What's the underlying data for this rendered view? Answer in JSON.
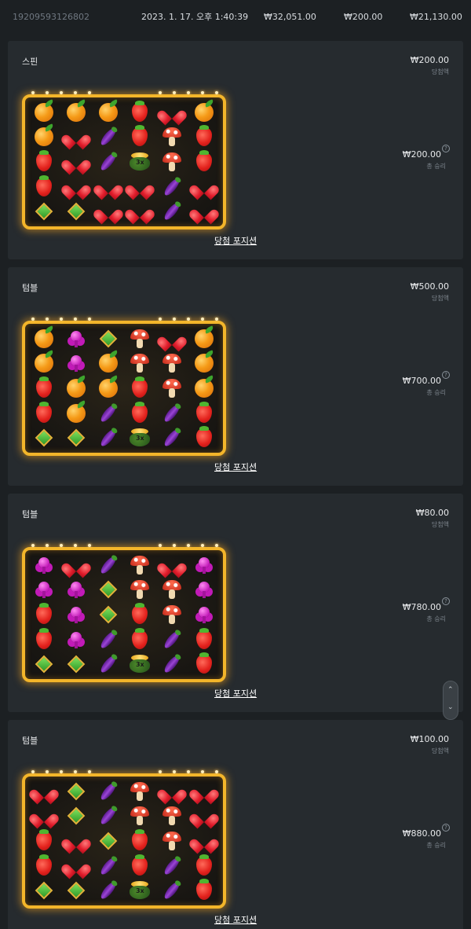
{
  "header": {
    "id": "19209593126802",
    "datetime": "2023. 1. 17. 오후 1:40:39",
    "amount1": "₩32,051.00",
    "amount2": "₩200.00",
    "amount3": "₩21,130.00"
  },
  "labels": {
    "win_amount_label": "당첨액",
    "total_win_label": "총 승리",
    "win_positions_link": "당첨 포지션",
    "help_icon": "?"
  },
  "rounds": [
    {
      "title": "스핀",
      "win_amount": "₩200.00",
      "total_win": "₩200.00",
      "grid": [
        [
          "orange",
          "orange",
          "orange",
          "strawberry",
          "heart",
          "orange"
        ],
        [
          "orange",
          "heart",
          "eggplant",
          "strawberry",
          "mushroom",
          "strawberry"
        ],
        [
          "strawberry",
          "heart",
          "eggplant",
          "pot",
          "mushroom",
          "strawberry"
        ],
        [
          "strawberry",
          "heart",
          "heart",
          "heart",
          "eggplant",
          "heart"
        ],
        [
          "diamond",
          "diamond",
          "heart",
          "heart",
          "eggplant",
          "heart"
        ]
      ]
    },
    {
      "title": "텀블",
      "win_amount": "₩500.00",
      "total_win": "₩700.00",
      "grid": [
        [
          "orange",
          "club",
          "diamond",
          "mushroom",
          "heart",
          "orange"
        ],
        [
          "orange",
          "club",
          "orange",
          "mushroom",
          "mushroom",
          "orange"
        ],
        [
          "strawberry",
          "orange",
          "orange",
          "strawberry",
          "mushroom",
          "orange"
        ],
        [
          "strawberry",
          "orange",
          "eggplant",
          "strawberry",
          "eggplant",
          "strawberry"
        ],
        [
          "diamond",
          "diamond",
          "eggplant",
          "pot",
          "eggplant",
          "strawberry"
        ]
      ]
    },
    {
      "title": "텀블",
      "win_amount": "₩80.00",
      "total_win": "₩780.00",
      "grid": [
        [
          "club",
          "heart",
          "eggplant",
          "mushroom",
          "heart",
          "club"
        ],
        [
          "club",
          "club",
          "diamond",
          "mushroom",
          "mushroom",
          "club"
        ],
        [
          "strawberry",
          "club",
          "diamond",
          "strawberry",
          "mushroom",
          "club"
        ],
        [
          "strawberry",
          "club",
          "eggplant",
          "strawberry",
          "eggplant",
          "strawberry"
        ],
        [
          "diamond",
          "diamond",
          "eggplant",
          "pot",
          "eggplant",
          "strawberry"
        ]
      ]
    },
    {
      "title": "텀블",
      "win_amount": "₩100.00",
      "total_win": "₩880.00",
      "grid": [
        [
          "heart",
          "diamond",
          "eggplant",
          "mushroom",
          "heart",
          "heart"
        ],
        [
          "heart",
          "diamond",
          "eggplant",
          "mushroom",
          "mushroom",
          "heart"
        ],
        [
          "strawberry",
          "heart",
          "diamond",
          "strawberry",
          "mushroom",
          "heart"
        ],
        [
          "strawberry",
          "heart",
          "eggplant",
          "strawberry",
          "eggplant",
          "strawberry"
        ],
        [
          "diamond",
          "diamond",
          "eggplant",
          "pot",
          "eggplant",
          "strawberry"
        ]
      ]
    }
  ],
  "pot_multiplier": "3x",
  "scroll": {
    "up": "⌃",
    "down": "⌄"
  }
}
